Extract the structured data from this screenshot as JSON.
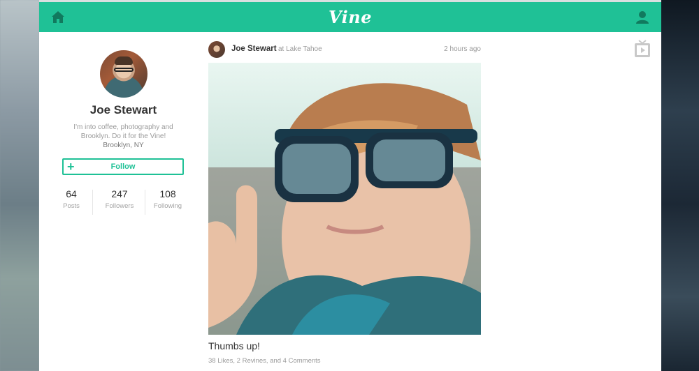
{
  "app": {
    "logo_text": "Vine",
    "accent_color": "#1fc196"
  },
  "nav": {
    "home_icon": "home-icon",
    "user_icon": "user-icon",
    "tv_icon": "tv-icon"
  },
  "profile": {
    "name": "Joe Stewart",
    "bio": "I'm into coffee, photography and Brooklyn. Do it for the Vine!",
    "location": "Brooklyn, NY",
    "follow_label": "Follow",
    "stats": [
      {
        "value": "64",
        "label": "Posts"
      },
      {
        "value": "247",
        "label": "Followers"
      },
      {
        "value": "108",
        "label": "Following"
      }
    ]
  },
  "post": {
    "author": "Joe Stewart",
    "location": "at Lake Tahoe",
    "time": "2 hours ago",
    "caption": "Thumbs up!",
    "engagement": "38 Likes, 2 Revines, and 4 Comments"
  }
}
